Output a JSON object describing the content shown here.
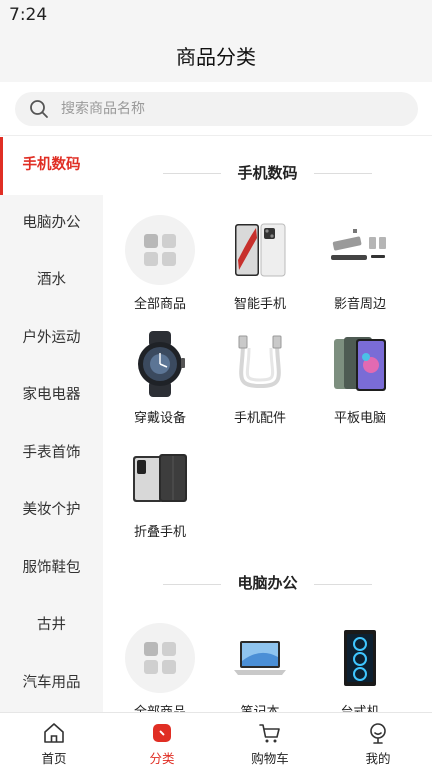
{
  "status": {
    "time": "7:24"
  },
  "header": {
    "title": "商品分类"
  },
  "search": {
    "placeholder": "搜索商品名称"
  },
  "sidebar": {
    "items": [
      {
        "label": "手机数码",
        "active": true
      },
      {
        "label": "电脑办公"
      },
      {
        "label": "酒水"
      },
      {
        "label": "户外运动"
      },
      {
        "label": "家电电器"
      },
      {
        "label": "手表首饰"
      },
      {
        "label": "美妆个护"
      },
      {
        "label": "服饰鞋包"
      },
      {
        "label": "古井"
      },
      {
        "label": "汽车用品"
      }
    ]
  },
  "sections": [
    {
      "title": "手机数码",
      "items": [
        {
          "label": "全部商品",
          "icon": "all-products-icon"
        },
        {
          "label": "智能手机",
          "icon": "smartphone-image"
        },
        {
          "label": "影音周边",
          "icon": "speaker-set-image"
        },
        {
          "label": "穿戴设备",
          "icon": "smartwatch-image"
        },
        {
          "label": "手机配件",
          "icon": "usb-cable-image"
        },
        {
          "label": "平板电脑",
          "icon": "tablet-image"
        },
        {
          "label": "折叠手机",
          "icon": "foldable-phone-image"
        }
      ]
    },
    {
      "title": "电脑办公",
      "items": [
        {
          "label": "全部商品",
          "icon": "all-products-icon"
        },
        {
          "label": "笔记本",
          "icon": "laptop-image"
        },
        {
          "label": "台式机",
          "icon": "desktop-pc-image"
        }
      ]
    }
  ],
  "tabbar": {
    "items": [
      {
        "label": "首页",
        "icon": "home-icon"
      },
      {
        "label": "分类",
        "icon": "category-icon",
        "active": true
      },
      {
        "label": "购物车",
        "icon": "cart-icon"
      },
      {
        "label": "我的",
        "icon": "profile-icon"
      }
    ]
  },
  "colors": {
    "accent": "#e02e24",
    "background": "#f5f5f5"
  }
}
